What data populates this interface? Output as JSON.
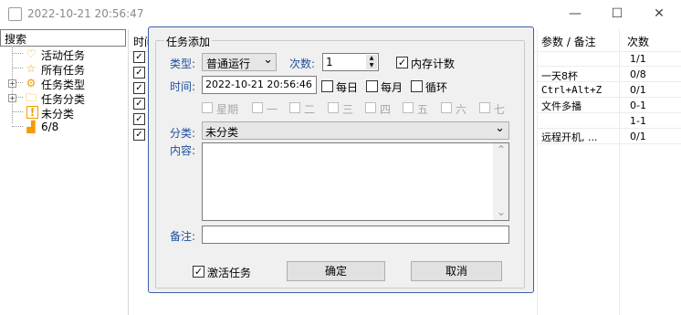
{
  "window": {
    "title": "2022-10-21 20:56:47",
    "minimize_glyph": "—",
    "maximize_glyph": "☐",
    "close_glyph": "✕"
  },
  "search": {
    "label": "搜索"
  },
  "tree": {
    "items": [
      {
        "label": "活动任务",
        "icon": "heart-icon",
        "glyph": "♡"
      },
      {
        "label": "所有任务",
        "icon": "star-icon",
        "glyph": "☆"
      },
      {
        "label": "任务类型",
        "icon": "gear-icon",
        "glyph": "⚙"
      },
      {
        "label": "任务分类",
        "icon": "folder-icon",
        "glyph": "🗀"
      },
      {
        "label": "未分类",
        "icon": "warning-icon",
        "glyph": "!"
      },
      {
        "label": "6/8",
        "icon": "chart-icon",
        "glyph": "▟"
      }
    ],
    "expander": "+"
  },
  "background_table": {
    "time_header": "时间",
    "param_header": "参数 / 备注",
    "count_header": "次数",
    "rows": [
      {
        "param": "",
        "count": "1/1",
        "checked": "✓"
      },
      {
        "param": "一天8杯",
        "count": "0/8",
        "checked": "✓"
      },
      {
        "param": "Ctrl+Alt+Z",
        "count": "0/1",
        "checked": "✓"
      },
      {
        "param": "文件多播",
        "count": "0-1",
        "checked": "✓"
      },
      {
        "param": "",
        "count": "1-1",
        "checked": "✓"
      },
      {
        "param": "远程开机, ...",
        "count": "0/1",
        "checked": "✓"
      }
    ]
  },
  "dialog": {
    "title": "任务添加",
    "type_label": "类型:",
    "type_value": "普通运行",
    "count_label": "次数:",
    "count_value": "1",
    "memory_count_label": "内存计数",
    "memory_count_checked": "✓",
    "time_label": "时间:",
    "time_value": "2022-10-21 20:56:46",
    "daily_label": "每日",
    "monthly_label": "每月",
    "loop_label": "循环",
    "weekdays": [
      "星期",
      "一",
      "二",
      "三",
      "四",
      "五",
      "六",
      "七"
    ],
    "category_label": "分类:",
    "category_value": "未分类",
    "content_label": "内容:",
    "note_label": "备注:",
    "activate_label": "激活任务",
    "activate_checked": "✓",
    "ok_label": "确定",
    "cancel_label": "取消",
    "dropdown_glyph": "⌄",
    "spin_up": "▲",
    "spin_down": "▼",
    "scroll_up": "⌃",
    "scroll_down": "⌄"
  },
  "colors": {
    "label_blue": "#1f4f9c",
    "dialog_border": "#3c5fa8",
    "icon_orange": "#f59a00"
  }
}
